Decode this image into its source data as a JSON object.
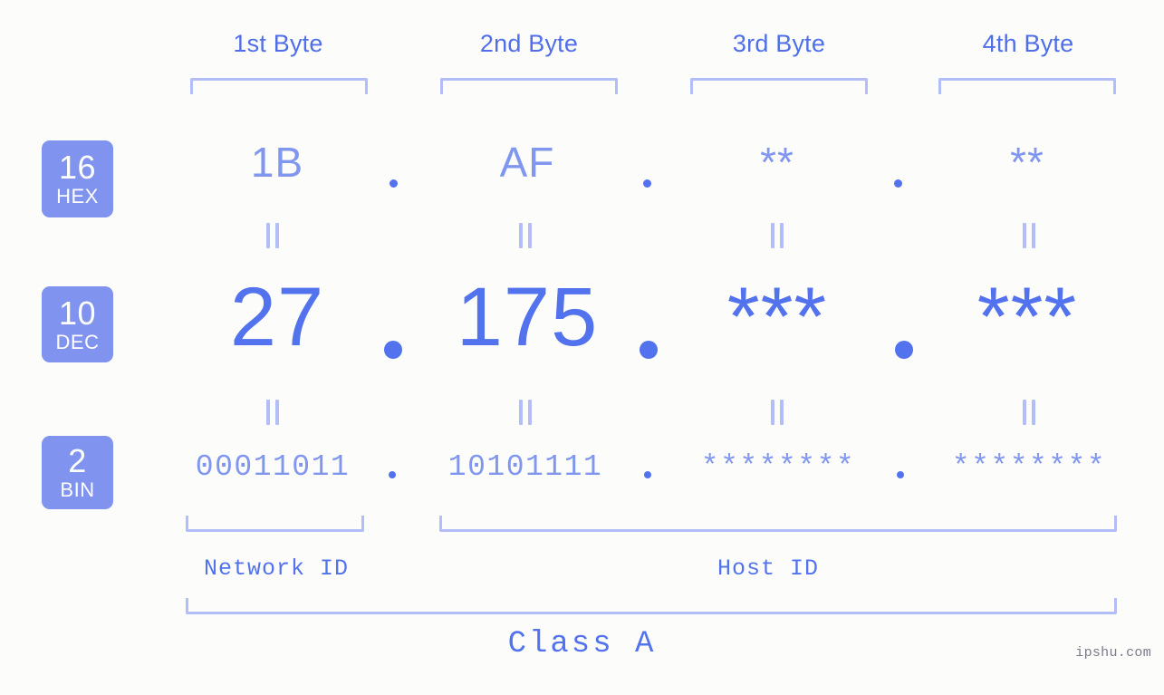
{
  "colors": {
    "background": "#fcfdfa",
    "accent_strong": "#5272ee",
    "accent_mid": "#8096ef",
    "accent_light": "#b3bdf7",
    "badge_fill": "#7f93ef",
    "badge_text": "#ffffff"
  },
  "byte_headers": [
    {
      "label": "1st Byte"
    },
    {
      "label": "2nd Byte"
    },
    {
      "label": "3rd Byte"
    },
    {
      "label": "4th Byte"
    }
  ],
  "bases": [
    {
      "num": "16",
      "abbr": "HEX"
    },
    {
      "num": "10",
      "abbr": "DEC"
    },
    {
      "num": "2",
      "abbr": "BIN"
    }
  ],
  "rows": {
    "hex": {
      "base_num": "16",
      "base_abbr": "HEX",
      "values": [
        "1B",
        "AF",
        "**",
        "**"
      ]
    },
    "dec": {
      "base_num": "10",
      "base_abbr": "DEC",
      "values": [
        "27",
        "175",
        "***",
        "***"
      ]
    },
    "bin": {
      "base_num": "2",
      "base_abbr": "BIN",
      "values": [
        "00011011",
        "10101111",
        "********",
        "********"
      ]
    }
  },
  "separators": {
    "octet_dot": ".",
    "equals_mark": "‖"
  },
  "id_labels": {
    "network": "Network ID",
    "host": "Host ID"
  },
  "class_label": "Class A",
  "watermark": "ipshu.com",
  "chart_data": {
    "type": "table",
    "title": "Class A",
    "columns": [
      "1st Byte",
      "2nd Byte",
      "3rd Byte",
      "4th Byte"
    ],
    "rows": [
      {
        "base": "16",
        "base_name": "HEX",
        "cells": [
          "1B",
          "AF",
          "**",
          "**"
        ]
      },
      {
        "base": "10",
        "base_name": "DEC",
        "cells": [
          "27",
          "175",
          "***",
          "***"
        ]
      },
      {
        "base": "2",
        "base_name": "BIN",
        "cells": [
          "00011011",
          "10101111",
          "********",
          "********"
        ]
      }
    ],
    "groupings": [
      {
        "label": "Network ID",
        "bytes": [
          1
        ]
      },
      {
        "label": "Host ID",
        "bytes": [
          2,
          3,
          4
        ]
      },
      {
        "label": "Class A",
        "bytes": [
          1,
          2,
          3,
          4
        ]
      }
    ]
  }
}
